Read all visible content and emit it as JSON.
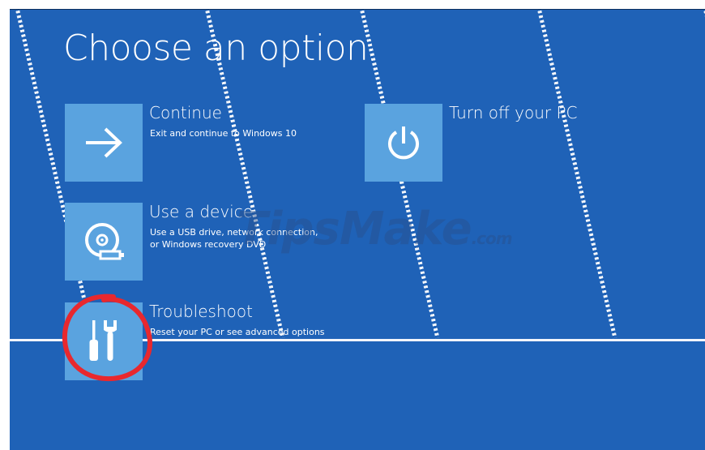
{
  "page": {
    "title": "Choose an option"
  },
  "options": [
    {
      "title": "Continue",
      "desc": [
        "Exit and continue to Windows 10"
      ],
      "icon": "arrow-right-icon"
    },
    {
      "title": "Use a device",
      "desc": [
        "Use a USB drive, network connection,",
        "or Windows recovery DVD"
      ],
      "icon": "disc-drive-icon"
    },
    {
      "title": "Troubleshoot",
      "desc": [
        "Reset your PC or see advanced options"
      ],
      "icon": "tools-icon"
    },
    {
      "title": "Turn off your PC",
      "desc": [],
      "icon": "power-icon"
    }
  ],
  "watermark": {
    "main": "TipsMake",
    "suffix": ".com"
  },
  "colors": {
    "background": "#1f62b7",
    "tile": "#5aa3df",
    "text": "#ffffff",
    "annotation": "#e8282e"
  }
}
